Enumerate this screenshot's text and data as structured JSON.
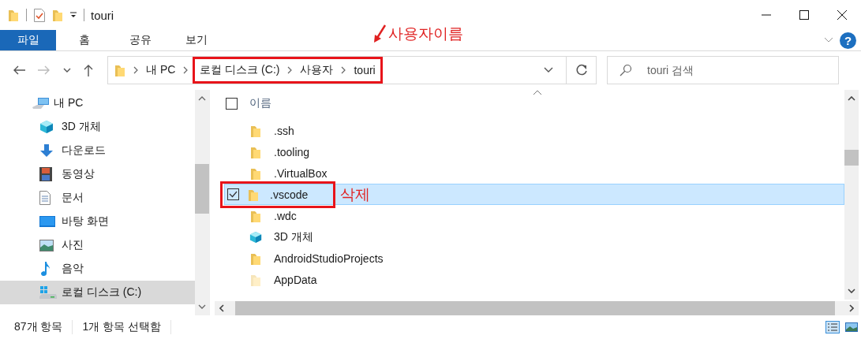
{
  "title_bar": {
    "title": "touri"
  },
  "ribbon": {
    "tabs": [
      {
        "label": "파일",
        "selected": true
      },
      {
        "label": "홈",
        "selected": false
      },
      {
        "label": "공유",
        "selected": false
      },
      {
        "label": "보기",
        "selected": false
      }
    ],
    "help_glyph": "?"
  },
  "address": {
    "crumbs": [
      "내 PC",
      "로컬 디스크 (C:)",
      "사용자",
      "touri"
    ],
    "note": "사용자이름"
  },
  "search": {
    "placeholder": "touri 검색"
  },
  "nav": {
    "items": [
      {
        "label": "내 PC",
        "kind": "pc",
        "selected": false,
        "children": [
          {
            "label": "3D 개체",
            "kind": "cube",
            "selected": false
          },
          {
            "label": "다운로드",
            "kind": "download",
            "selected": false
          },
          {
            "label": "동영상",
            "kind": "video",
            "selected": false
          },
          {
            "label": "문서",
            "kind": "document",
            "selected": false
          },
          {
            "label": "바탕 화면",
            "kind": "desktop",
            "selected": false
          },
          {
            "label": "사진",
            "kind": "photo",
            "selected": false
          },
          {
            "label": "음악",
            "kind": "music",
            "selected": false
          },
          {
            "label": "로컬 디스크 (C:)",
            "kind": "drive",
            "selected": true
          }
        ]
      }
    ]
  },
  "files": {
    "header": "이름",
    "all_checked": false,
    "rows": [
      {
        "name": ".ssh",
        "kind": "folder",
        "hidden": false,
        "selected": false,
        "checked": false
      },
      {
        "name": ".tooling",
        "kind": "folder",
        "hidden": false,
        "selected": false,
        "checked": false
      },
      {
        "name": ".VirtualBox",
        "kind": "folder",
        "hidden": false,
        "selected": false,
        "checked": false
      },
      {
        "name": ".vscode",
        "kind": "folder",
        "hidden": false,
        "selected": true,
        "checked": true,
        "note": "삭제"
      },
      {
        "name": ".wdc",
        "kind": "folder",
        "hidden": false,
        "selected": false,
        "checked": false
      },
      {
        "name": "3D 개체",
        "kind": "cube",
        "hidden": false,
        "selected": false,
        "checked": false
      },
      {
        "name": "AndroidStudioProjects",
        "kind": "folder",
        "hidden": false,
        "selected": false,
        "checked": false
      },
      {
        "name": "AppData",
        "kind": "folder",
        "hidden": true,
        "selected": false,
        "checked": false
      }
    ]
  },
  "status_bar": [
    "87개 항목",
    "1개 항목 선택함"
  ]
}
